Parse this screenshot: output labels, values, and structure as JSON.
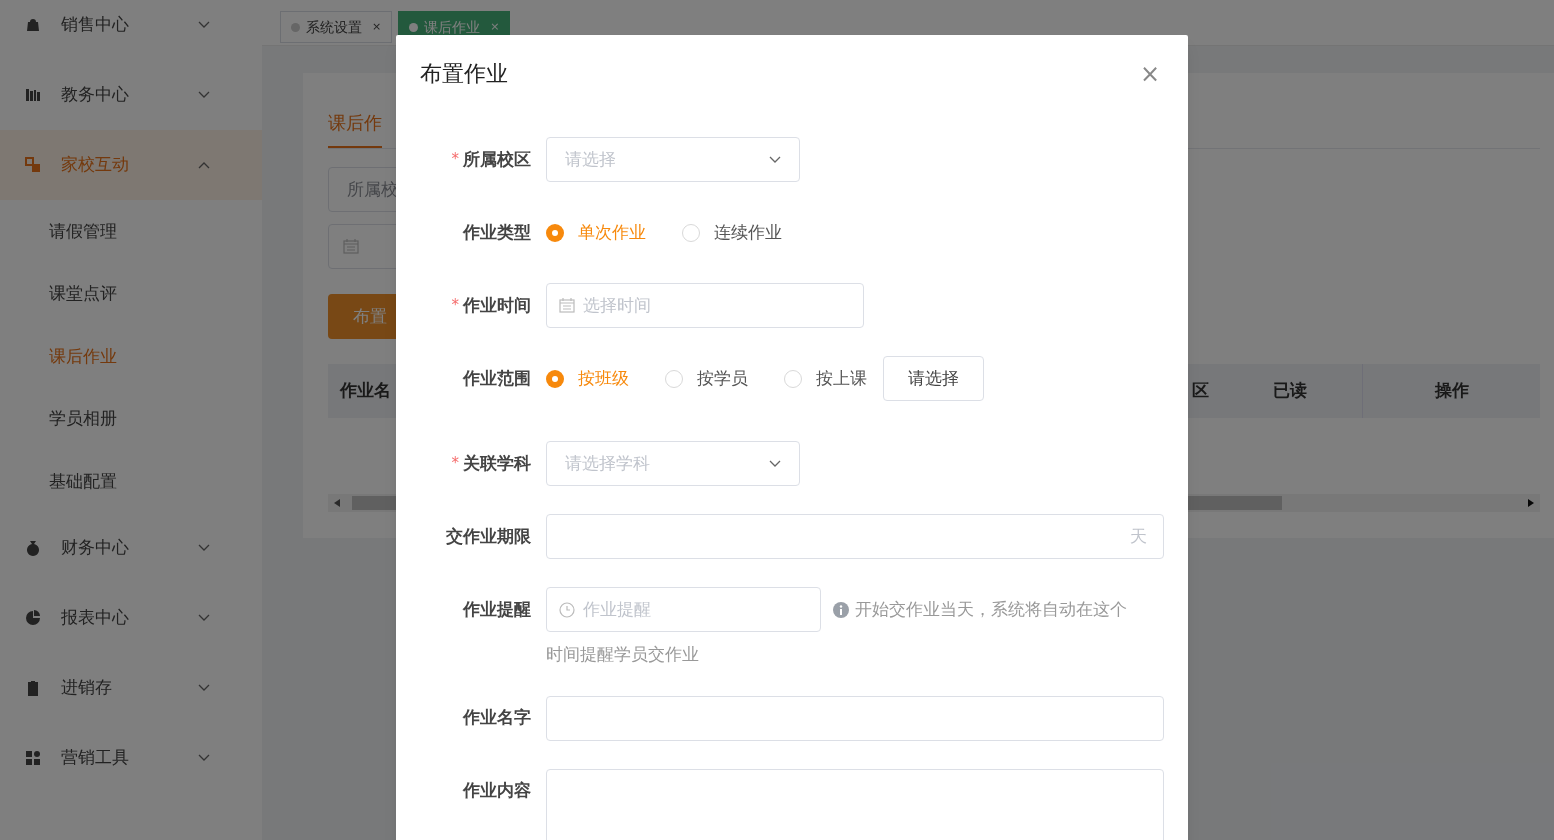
{
  "sidebar": {
    "items": [
      {
        "label": "销售中心",
        "expanded": false,
        "selected": false
      },
      {
        "label": "教务中心",
        "expanded": false,
        "selected": false
      },
      {
        "label": "家校互动",
        "expanded": true,
        "selected": true,
        "children": [
          {
            "label": "请假管理",
            "selected": false
          },
          {
            "label": "课堂点评",
            "selected": false
          },
          {
            "label": "课后作业",
            "selected": true
          },
          {
            "label": "学员相册",
            "selected": false
          },
          {
            "label": "基础配置",
            "selected": false
          }
        ]
      },
      {
        "label": "财务中心",
        "expanded": false,
        "selected": false
      },
      {
        "label": "报表中心",
        "expanded": false,
        "selected": false
      },
      {
        "label": "进销存",
        "expanded": false,
        "selected": false
      },
      {
        "label": "营销工具",
        "expanded": false,
        "selected": false
      }
    ]
  },
  "page_tabs": [
    {
      "label": "系统设置",
      "close": "×",
      "selected": false
    },
    {
      "label": "课后作业",
      "close": "×",
      "selected": true
    }
  ],
  "card": {
    "tab": "课后作",
    "filter_placeholder": "所属校",
    "button": "布置",
    "table": {
      "columns": [
        "作业名",
        "区",
        "已读",
        "操作"
      ]
    }
  },
  "modal": {
    "title": "布置作业",
    "close": "×",
    "fields": [
      {
        "kind": "select",
        "label": "所属校区",
        "required_mark": "*",
        "placeholder": "请选择"
      },
      {
        "kind": "radio",
        "label": "作业类型",
        "options": [
          {
            "label": "单次作业",
            "selected": true
          },
          {
            "label": "连续作业",
            "selected": false
          }
        ]
      },
      {
        "kind": "date",
        "label": "作业时间",
        "required_mark": "*",
        "placeholder": "选择时间"
      },
      {
        "kind": "radio",
        "label": "作业范围",
        "options": [
          {
            "label": "按班级",
            "selected": true
          },
          {
            "label": "按学员",
            "selected": false
          },
          {
            "label": "按上课",
            "selected": false
          }
        ],
        "button": "请选择"
      },
      {
        "kind": "select",
        "label": "关联学科",
        "required_mark": "*",
        "placeholder": "请选择学科"
      },
      {
        "kind": "suffix",
        "label": "交作业期限",
        "suffix": "天"
      },
      {
        "kind": "time",
        "label": "作业提醒",
        "placeholder": "作业提醒",
        "help": "开始交作业当天，系统将自动在这个",
        "help_more": "时间提醒学员交作业"
      },
      {
        "kind": "text",
        "label": "作业名字"
      },
      {
        "kind": "textarea",
        "label": "作业内容"
      }
    ]
  }
}
